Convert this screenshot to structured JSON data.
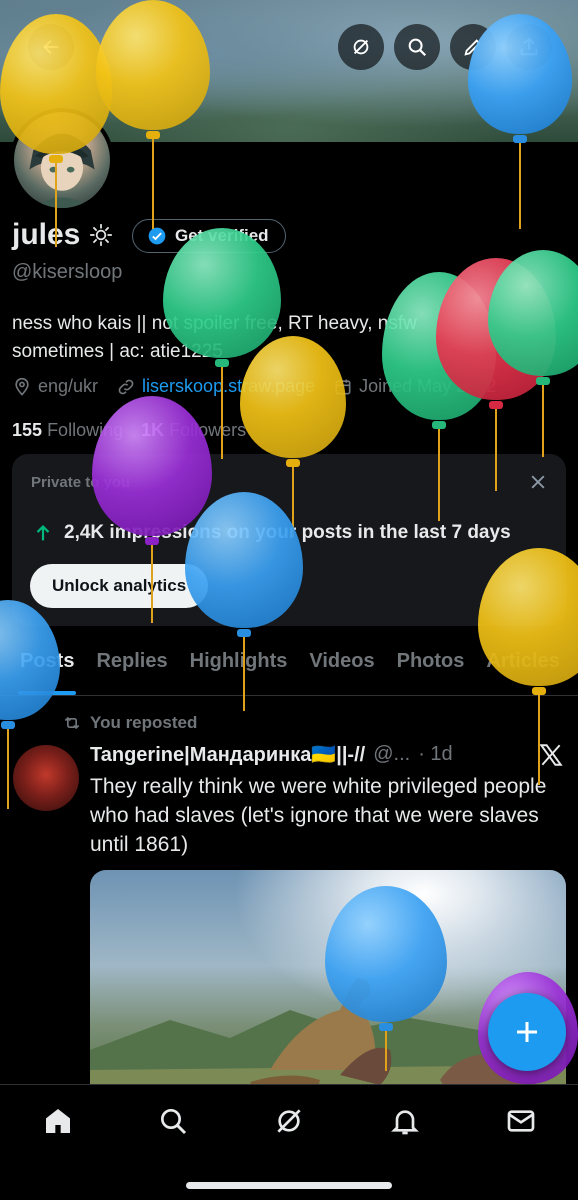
{
  "profile": {
    "display_name": "jules",
    "verify_label": "Get verified",
    "handle": "@kisersloop",
    "bio_line1": "ness who kais || not spoiler free, RT heavy, nsfw",
    "bio_line2": "sometimes | ac: atie1225",
    "location": "eng/ukr",
    "link": "liserskoop.straw.page",
    "joined": "Joined May 2022",
    "following_count": "155",
    "following_label": "Following",
    "followers_count": "1K",
    "followers_label": "Followers"
  },
  "analytics_card": {
    "title": "Private to you",
    "stat": "2,4K impressions on your posts in the last 7 days",
    "button": "Unlock analytics"
  },
  "tabs": [
    {
      "label": "Posts"
    },
    {
      "label": "Replies"
    },
    {
      "label": "Highlights"
    },
    {
      "label": "Videos"
    },
    {
      "label": "Photos"
    },
    {
      "label": "Articles"
    }
  ],
  "post": {
    "repost_label": "You reposted",
    "author_name": "Tangerine|Мандаринка🇺🇦||-//",
    "author_handle": "@...",
    "time": "· 1d",
    "text": "They really think we were white privileged people who had slaves (let's ignore that we were slaves until 1861)"
  },
  "colors": {
    "accent": "#1d9bf0",
    "background": "#000000",
    "card": "#16181c",
    "muted": "#71767b"
  },
  "icons": [
    "back-arrow-icon",
    "grok-icon",
    "search-icon",
    "edit-icon",
    "share-icon",
    "location-icon",
    "link-icon",
    "calendar-icon",
    "home-icon",
    "explore-icon",
    "notifications-icon",
    "messages-icon",
    "compose-icon"
  ]
}
